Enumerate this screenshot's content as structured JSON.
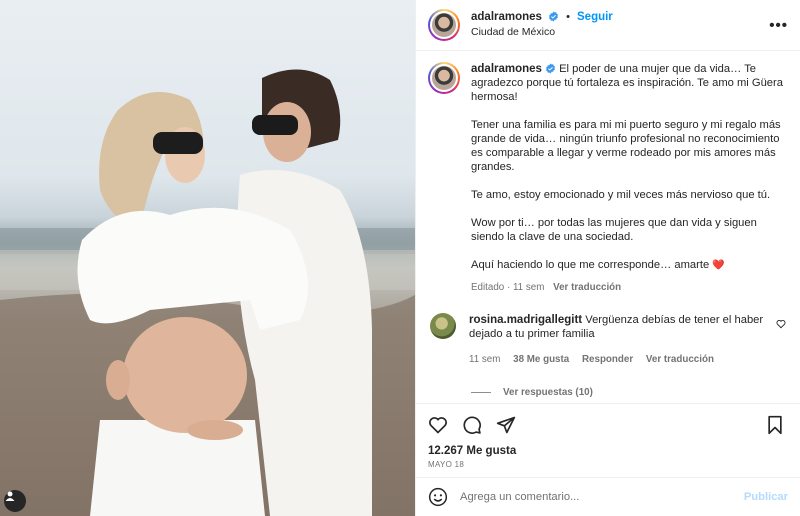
{
  "post": {
    "username": "adalramones",
    "follow_label": "Seguir",
    "location": "Ciudad de México",
    "more_glyph": "•••",
    "caption": {
      "username": "adalramones",
      "paragraphs": [
        "El poder de una mujer que da vida… Te agradezco porque tú fortaleza es inspiración. Te amo mi Güera hermosa!",
        "Tener una familia es para mi mi puerto seguro y mi regalo más grande de vida… ningún triunfo profesional no reconocimiento es comparable a llegar y verme rodeado por mis amores más grandes.",
        "Te amo, estoy emocionado y mil veces más nervioso que tú.",
        "Wow por ti… por todas las mujeres que dan vida y siguen siendo la clave de una sociedad."
      ],
      "last_line": "Aquí haciendo lo que me corresponde… amarte",
      "heart_emoji": "❤️",
      "edited_label": "Editado",
      "age": "11 sem",
      "translate_label": "Ver traducción"
    },
    "comment": {
      "username": "rosina.madrigallegitt",
      "text": "Vergüenza debías de tener el haber dejado a tu primer familia",
      "age": "11 sem",
      "likes": "38 Me gusta",
      "reply_label": "Responder",
      "translate_label": "Ver traducción",
      "view_replies": "Ver respuestas (10)"
    },
    "likes": "12.267 Me gusta",
    "date": "MAYO 18",
    "add_comment_placeholder": "Agrega un comentario...",
    "publish_label": "Publicar"
  },
  "colors": {
    "accent": "#0095f6",
    "verified": "#3897f0",
    "publish_disabled": "#b3dbff",
    "secondary_text": "#737373"
  },
  "icons": [
    "verified-icon",
    "more-options-icon",
    "heart-icon",
    "comment-icon",
    "share-icon",
    "bookmark-icon",
    "emoji-icon",
    "user-tag-icon",
    "comment-like-icon"
  ]
}
